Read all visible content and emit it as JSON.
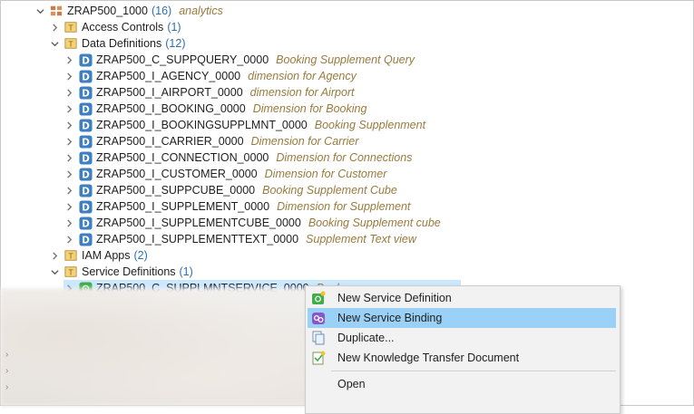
{
  "tree": {
    "package": {
      "name": "ZRAP500_1000",
      "count": "(16)",
      "description": "analytics"
    },
    "access_controls": {
      "label": "Access Controls",
      "count": "(1)"
    },
    "data_definitions": {
      "label": "Data Definitions",
      "count": "(12)",
      "items": [
        {
          "name": "ZRAP500_C_SUPPQUERY_0000",
          "desc": "Booking Supplement Query"
        },
        {
          "name": "ZRAP500_I_AGENCY_0000",
          "desc": "dimension for Agency"
        },
        {
          "name": "ZRAP500_I_AIRPORT_0000",
          "desc": "dimension for Airport"
        },
        {
          "name": "ZRAP500_I_BOOKING_0000",
          "desc": "Dimension for Booking"
        },
        {
          "name": "ZRAP500_I_BOOKINGSUPPLMNT_0000",
          "desc": "Booking Supplenment"
        },
        {
          "name": "ZRAP500_I_CARRIER_0000",
          "desc": "Dimension for Carrier"
        },
        {
          "name": "ZRAP500_I_CONNECTION_0000",
          "desc": "Dimension for Connections"
        },
        {
          "name": "ZRAP500_I_CUSTOMER_0000",
          "desc": "Dimension for Customer"
        },
        {
          "name": "ZRAP500_I_SUPPCUBE_0000",
          "desc": "Booking Supplement Cube"
        },
        {
          "name": "ZRAP500_I_SUPPLEMENT_0000",
          "desc": "Dimension for Supplement"
        },
        {
          "name": "ZRAP500_I_SUPPLEMENTCUBE_0000",
          "desc": "Booking Supplement cube"
        },
        {
          "name": "ZRAP500_I_SUPPLEMENTTEXT_0000",
          "desc": "Supplement Text view"
        }
      ]
    },
    "iam_apps": {
      "label": "IAM Apps",
      "count": "(2)"
    },
    "service_definitions": {
      "label": "Service Definitions",
      "count": "(1)",
      "item": {
        "name": "ZRAP500_C_SUPPLMNTSERVICE_0000",
        "desc": "Book"
      }
    }
  },
  "context_menu": {
    "items": [
      {
        "label": "New Service Definition",
        "icon": "new-service-definition-icon"
      },
      {
        "label": "New Service Binding",
        "icon": "new-service-binding-icon",
        "highlighted": true
      },
      {
        "label": "Duplicate...",
        "icon": "duplicate-icon"
      },
      {
        "label": "New Knowledge Transfer Document",
        "icon": "knowledge-transfer-icon"
      },
      {
        "label": "Open",
        "icon": ""
      }
    ]
  },
  "colors": {
    "selection": "#cce8ff",
    "menu_highlight": "#9bd0f7",
    "count_blue": "#2e6fb4",
    "description_brown": "#9a7a3c",
    "dd_icon_blue": "#3d7fc1",
    "service_icon_green": "#3fae49"
  }
}
